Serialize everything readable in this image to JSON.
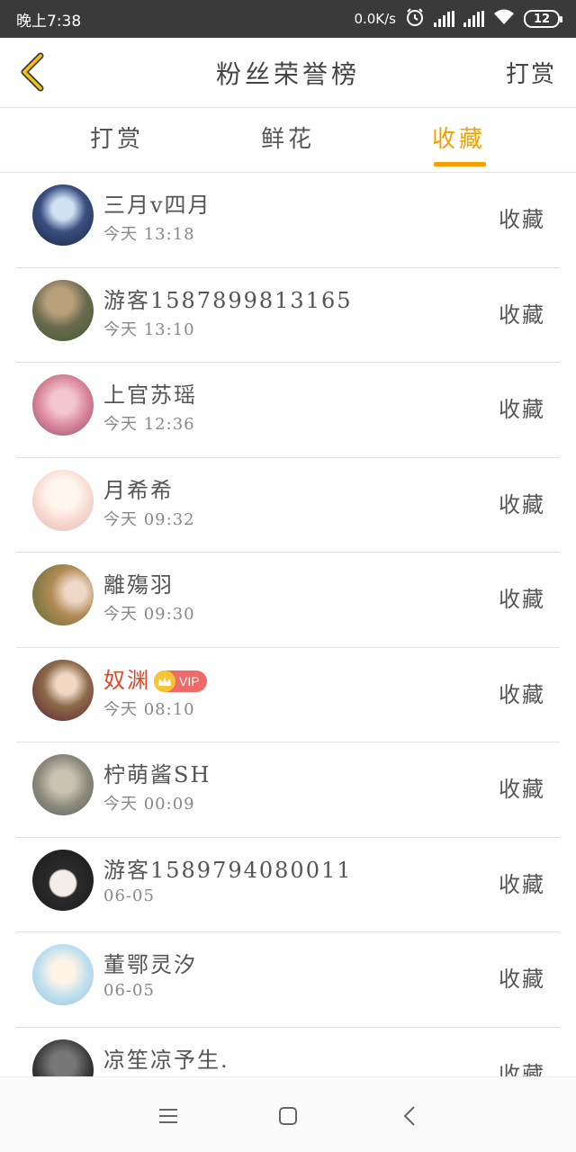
{
  "status_bar": {
    "time": "晚上7:38",
    "network_speed": "0.0K/s",
    "battery": "12",
    "icons": [
      "alarm-icon",
      "signal-icon",
      "signal-icon",
      "wifi-icon",
      "battery-icon"
    ]
  },
  "header": {
    "title": "粉丝荣誉榜",
    "action": "打赏",
    "back_icon": "chevron-left-icon"
  },
  "tabs": [
    {
      "label": "打赏",
      "active": false
    },
    {
      "label": "鲜花",
      "active": false
    },
    {
      "label": "收藏",
      "active": true
    }
  ],
  "accent_color": "#f5a000",
  "list": [
    {
      "name": "三月v四月",
      "time": "今天 13:18",
      "action": "收藏"
    },
    {
      "name": "游客1587899813165",
      "time": "今天 13:10",
      "action": "收藏"
    },
    {
      "name": "上官苏瑶",
      "time": "今天 12:36",
      "action": "收藏"
    },
    {
      "name": "月希希",
      "time": "今天 09:32",
      "action": "收藏"
    },
    {
      "name": "離殤羽",
      "time": "今天 09:30",
      "action": "收藏"
    },
    {
      "name": "奴渊",
      "vip": "VIP",
      "time": "今天 08:10",
      "action": "收藏"
    },
    {
      "name": "柠萌酱SH",
      "time": "今天 00:09",
      "action": "收藏"
    },
    {
      "name": "游客1589794080011",
      "time": "06-05",
      "action": "收藏"
    },
    {
      "name": "董鄂灵汐",
      "time": "06-05",
      "action": "收藏"
    },
    {
      "name": "凉笙凉予生.",
      "time": "",
      "action": "收藏"
    }
  ],
  "nav": [
    "menu-icon",
    "home-icon",
    "back-icon"
  ]
}
